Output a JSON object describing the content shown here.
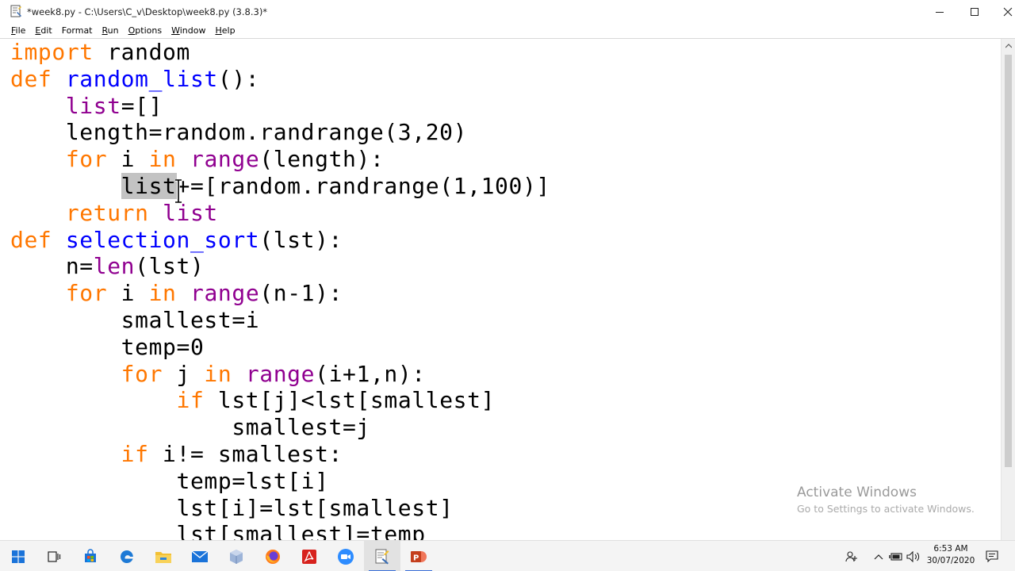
{
  "window": {
    "title": "*week8.py - C:\\Users\\C_v\\Desktop\\week8.py (3.8.3)*",
    "app_icon": "python-idle-icon",
    "controls": [
      "minimize-icon",
      "maximize-icon",
      "close-icon"
    ]
  },
  "menu": [
    {
      "mnemonic": "F",
      "rest": "ile"
    },
    {
      "mnemonic": "E",
      "rest": "dit"
    },
    {
      "mnemonic": "",
      "rest": "Format"
    },
    {
      "mnemonic": "R",
      "rest": "un"
    },
    {
      "mnemonic": "O",
      "rest": "ptions"
    },
    {
      "mnemonic": "W",
      "rest": "indow"
    },
    {
      "mnemonic": "H",
      "rest": "elp"
    }
  ],
  "editor": {
    "selected_text": "list",
    "lines": [
      [
        [
          "kw",
          "import"
        ],
        [
          "t",
          " random"
        ]
      ],
      [
        [
          "kw",
          "def"
        ],
        [
          "t",
          " "
        ],
        [
          "fn",
          "random_list"
        ],
        [
          "t",
          "():"
        ]
      ],
      [
        [
          "t",
          "    "
        ],
        [
          "bi",
          "list"
        ],
        [
          "t",
          "=[]"
        ]
      ],
      [
        [
          "t",
          "    length=random.randrange(3,20)"
        ]
      ],
      [
        [
          "t",
          "    "
        ],
        [
          "kw",
          "for"
        ],
        [
          "t",
          " i "
        ],
        [
          "kw",
          "in"
        ],
        [
          "t",
          " "
        ],
        [
          "bi",
          "range"
        ],
        [
          "t",
          "(length):"
        ]
      ],
      [
        [
          "t",
          "        "
        ],
        [
          "sel",
          "list"
        ],
        [
          "t",
          "+=[random.randrange(1,100)]"
        ]
      ],
      [
        [
          "t",
          "    "
        ],
        [
          "kw",
          "return"
        ],
        [
          "t",
          " "
        ],
        [
          "bi",
          "list"
        ]
      ],
      [
        [
          "kw",
          "def"
        ],
        [
          "t",
          " "
        ],
        [
          "fn",
          "selection_sort"
        ],
        [
          "t",
          "(lst):"
        ]
      ],
      [
        [
          "t",
          "    n="
        ],
        [
          "bi",
          "len"
        ],
        [
          "t",
          "(lst)"
        ]
      ],
      [
        [
          "t",
          "    "
        ],
        [
          "kw",
          "for"
        ],
        [
          "t",
          " i "
        ],
        [
          "kw",
          "in"
        ],
        [
          "t",
          " "
        ],
        [
          "bi",
          "range"
        ],
        [
          "t",
          "(n-1):"
        ]
      ],
      [
        [
          "t",
          "        smallest=i"
        ]
      ],
      [
        [
          "t",
          "        temp=0"
        ]
      ],
      [
        [
          "t",
          "        "
        ],
        [
          "kw",
          "for"
        ],
        [
          "t",
          " j "
        ],
        [
          "kw",
          "in"
        ],
        [
          "t",
          " "
        ],
        [
          "bi",
          "range"
        ],
        [
          "t",
          "(i+1,n):"
        ]
      ],
      [
        [
          "t",
          "            "
        ],
        [
          "kw",
          "if"
        ],
        [
          "t",
          " lst[j]<lst[smallest]"
        ]
      ],
      [
        [
          "t",
          "                smallest=j"
        ]
      ],
      [
        [
          "t",
          "        "
        ],
        [
          "kw",
          "if"
        ],
        [
          "t",
          " i!= smallest:"
        ]
      ],
      [
        [
          "t",
          "            temp=lst[i]"
        ]
      ],
      [
        [
          "t",
          "            lst[i]=lst[smallest]"
        ]
      ],
      [
        [
          "t",
          "            lst[smallest]=temp"
        ]
      ]
    ]
  },
  "colors": {
    "keyword": "#ff7700",
    "builtin": "#900090",
    "definition": "#0000ff",
    "selection": "#c3c3c3"
  },
  "watermark": {
    "title": "Activate Windows",
    "subtitle": "Go to Settings to activate Windows."
  },
  "taskbar": {
    "icons": [
      "windows-start-icon",
      "task-view-icon",
      "store-icon",
      "edge-icon",
      "file-explorer-icon",
      "mail-icon",
      "box-app-icon",
      "firefox-icon",
      "acrobat-icon",
      "zoom-icon",
      "python-idle-icon",
      "powerpoint-icon"
    ],
    "tray": [
      "people-icon",
      "chevron-up-icon",
      "battery-icon",
      "volume-icon",
      "notification-icon"
    ],
    "time": "6:53 AM",
    "date": "30/07/2020"
  }
}
